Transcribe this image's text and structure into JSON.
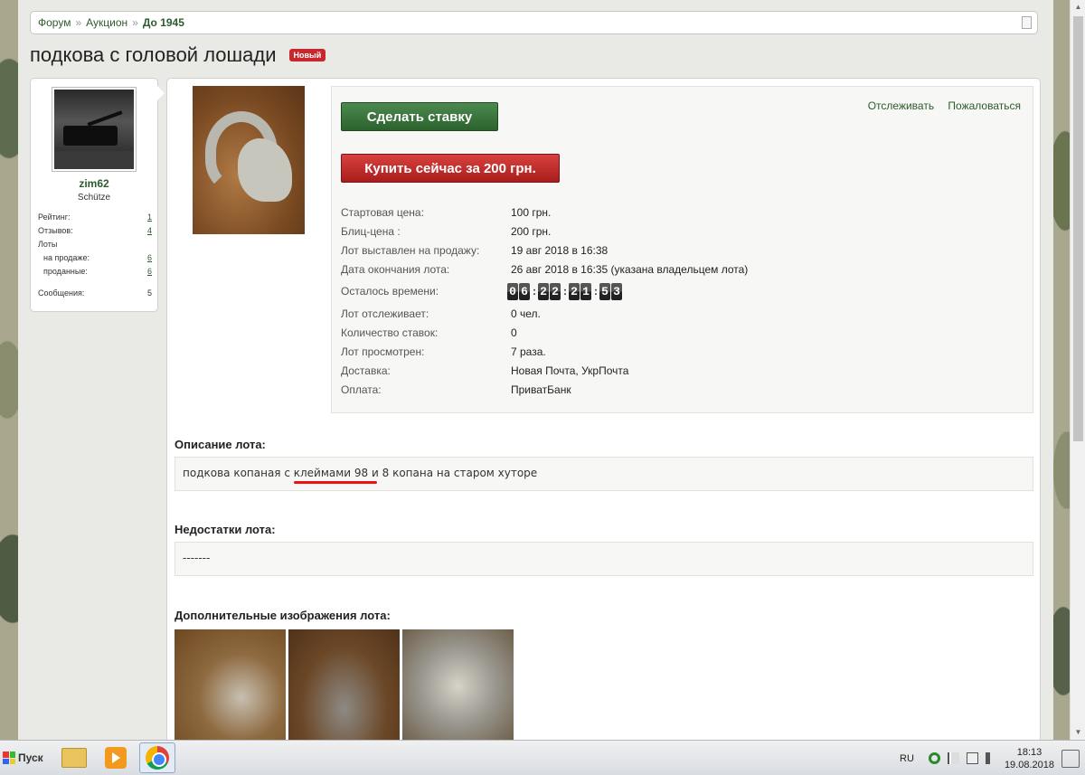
{
  "breadcrumb": {
    "items": [
      "Форум",
      "Аукцион"
    ],
    "current": "До 1945",
    "separator": "»"
  },
  "title": "подкова с головой лошади",
  "badge": "Новый",
  "user": {
    "name": "zim62",
    "rank": "Schütze",
    "stats": [
      {
        "label": "Рейтинг:",
        "value": "1"
      },
      {
        "label": "Отзывов:",
        "value": "4"
      },
      {
        "label": "Лоты",
        "value": ""
      },
      {
        "label": "на продаже:",
        "value": "6"
      },
      {
        "label": "проданные:",
        "value": "6"
      },
      {
        "label": "Сообщения:",
        "value": "5"
      }
    ]
  },
  "actions": {
    "bid_label": "Сделать ставку",
    "buy_label": "Купить сейчас за 200 грн.",
    "watch_label": "Отслеживать",
    "report_label": "Пожаловаться"
  },
  "details": {
    "start_price_label": "Стартовая цена:",
    "start_price": "100 грн.",
    "blitz_label": "Блиц-цена :",
    "blitz": "200 грн.",
    "listed_label": "Лот выставлен на продажу:",
    "listed": "19 авг 2018 в 16:38",
    "end_label": "Дата окончания лота:",
    "end": "26 авг 2018 в 16:35 (указана владельцем лота)",
    "remaining_label": "Осталось времени:",
    "timer": [
      "0",
      "6",
      "2",
      "2",
      "2",
      "1",
      "5",
      "3"
    ],
    "watchers_label": "Лот отслеживает:",
    "watchers": "0 чел.",
    "bids_label": "Количество ставок:",
    "bids": "0",
    "views_label": "Лот просмотрен:",
    "views": "7 раза.",
    "delivery_label": "Доставка:",
    "delivery": "Новая Почта, УкрПочта",
    "payment_label": "Оплата:",
    "payment": "ПриватБанк"
  },
  "description": {
    "title": "Описание лота:",
    "text": "подкова копаная с клеймами 98 и 8 копана на старом хуторе"
  },
  "flaws": {
    "title": "Недостатки лота:",
    "text": "-------"
  },
  "extra_images_title": "Дополнительные изображения лота:",
  "taskbar": {
    "start_label": "Пуск",
    "lang": "RU",
    "time": "18:13",
    "date": "19.08.2018"
  },
  "colors": {
    "accent_green": "#2d5b2d",
    "bid_button": "#3a7a3d",
    "buy_button": "#c22b2a",
    "badge": "#c8282d"
  }
}
